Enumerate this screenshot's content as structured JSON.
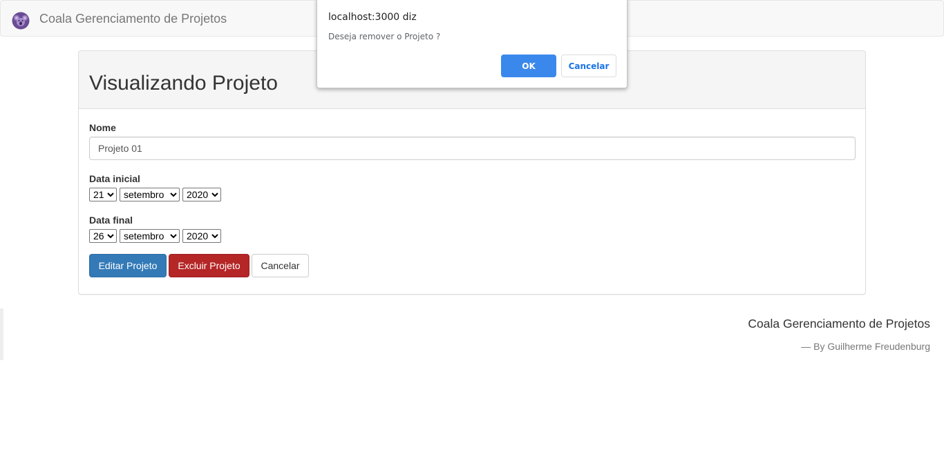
{
  "navbar": {
    "brand_title": "Coala Gerenciamento de Projetos",
    "logo_icon": "koala-icon"
  },
  "panel": {
    "title": "Visualizando Projeto",
    "nome": {
      "label": "Nome",
      "value": "Projeto 01"
    },
    "data_inicial": {
      "label": "Data inicial",
      "day": "21",
      "month": "setembro",
      "year": "2020"
    },
    "data_final": {
      "label": "Data final",
      "day": "26",
      "month": "setembro",
      "year": "2020"
    },
    "buttons": {
      "edit": "Editar Projeto",
      "delete": "Excluir Projeto",
      "cancel": "Cancelar"
    }
  },
  "footer": {
    "title": "Coala Gerenciamento de Projetos",
    "byline": "— By Guilherme Freudenburg"
  },
  "dialog": {
    "title": "localhost:3000 diz",
    "message": "Deseja remover o Projeto ?",
    "ok_label": "OK",
    "cancel_label": "Cancelar"
  },
  "colors": {
    "primary": "#337ab7",
    "danger": "#b52627",
    "dialog_ok": "#3b88ec",
    "dialog_cancel_text": "#1a73e8"
  }
}
